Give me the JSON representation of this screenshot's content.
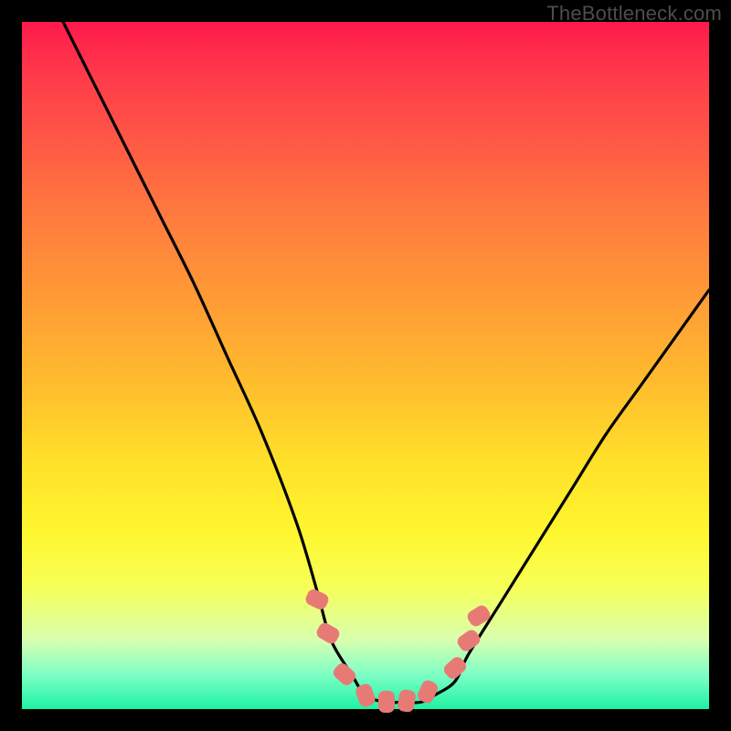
{
  "watermark": "TheBottleneck.com",
  "colors": {
    "background": "#000000",
    "gradient_top": "#ff1a4d",
    "gradient_bottom": "#1cf2a2",
    "curve": "#000000",
    "bead": "#e87a75",
    "watermark_text": "#4d4d4d"
  },
  "chart_data": {
    "type": "line",
    "title": "",
    "xlabel": "",
    "ylabel": "",
    "xlim": [
      0,
      100
    ],
    "ylim": [
      0,
      100
    ],
    "grid": false,
    "legend": false,
    "series": [
      {
        "name": "curve",
        "x": [
          6,
          10,
          15,
          20,
          25,
          30,
          35,
          40,
          43,
          45,
          48,
          50,
          53,
          55,
          58,
          60,
          63,
          65,
          70,
          75,
          80,
          85,
          90,
          95,
          100
        ],
        "y": [
          100,
          92,
          82,
          72,
          62,
          51,
          40,
          27,
          17,
          10,
          5,
          2,
          1,
          1,
          1,
          2,
          4,
          8,
          16,
          24,
          32,
          40,
          47,
          54,
          61
        ]
      }
    ],
    "markers": [
      {
        "x": 43.0,
        "y": 16.0,
        "angle_deg": -65
      },
      {
        "x": 44.5,
        "y": 11.0,
        "angle_deg": -60
      },
      {
        "x": 47.0,
        "y": 5.0,
        "angle_deg": -48
      },
      {
        "x": 50.0,
        "y": 2.0,
        "angle_deg": -20
      },
      {
        "x": 53.0,
        "y": 1.0,
        "angle_deg": 0
      },
      {
        "x": 56.0,
        "y": 1.2,
        "angle_deg": 10
      },
      {
        "x": 59.0,
        "y": 2.5,
        "angle_deg": 25
      },
      {
        "x": 63.0,
        "y": 6.0,
        "angle_deg": 48
      },
      {
        "x": 65.0,
        "y": 10.0,
        "angle_deg": 55
      },
      {
        "x": 66.5,
        "y": 13.5,
        "angle_deg": 58
      }
    ],
    "background_gradient": {
      "direction": "vertical",
      "stops": [
        {
          "pos": 0.0,
          "color": "#ff1a4d"
        },
        {
          "pos": 0.4,
          "color": "#ff9a36"
        },
        {
          "pos": 0.74,
          "color": "#fff62e"
        },
        {
          "pos": 1.0,
          "color": "#1cf2a2"
        }
      ]
    }
  }
}
